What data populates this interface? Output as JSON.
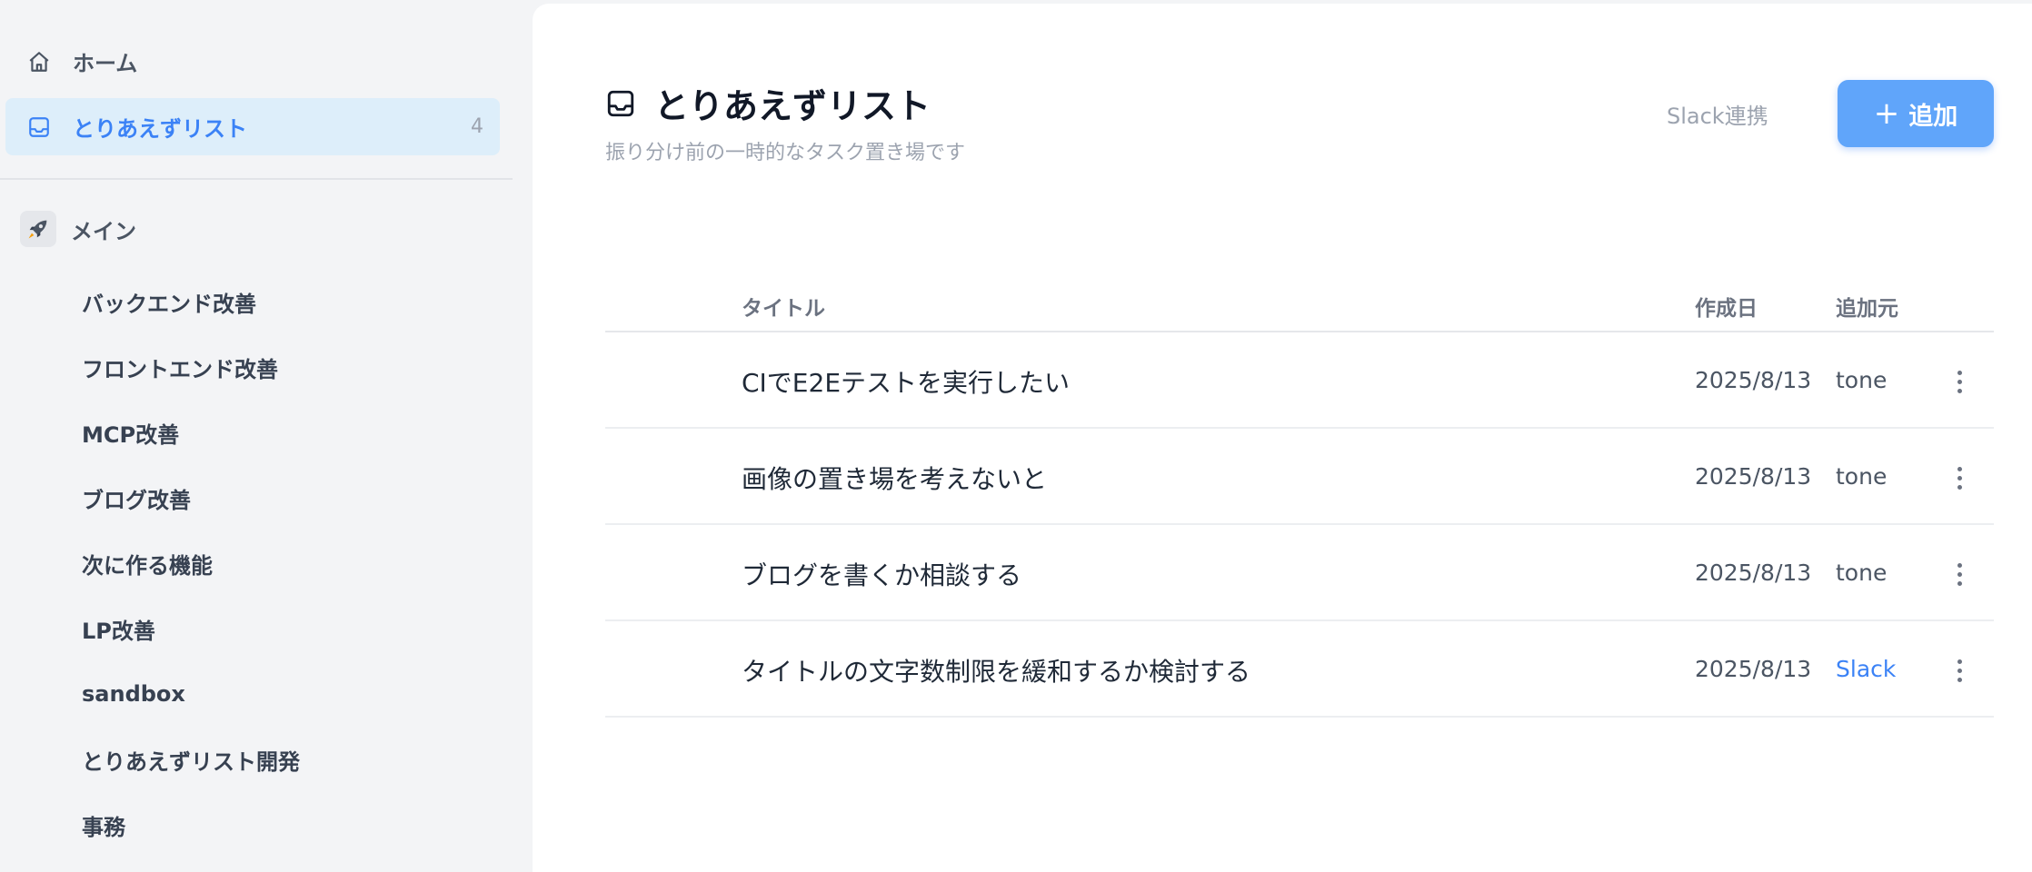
{
  "sidebar": {
    "nav": [
      {
        "label": "ホーム",
        "icon": "home-icon"
      },
      {
        "label": "とりあえずリスト",
        "icon": "inbox-icon",
        "count": "4",
        "active": true
      }
    ],
    "project": {
      "name": "メイン",
      "icon": "rocket-icon",
      "items": [
        {
          "label": "バックエンド改善"
        },
        {
          "label": "フロントエンド改善"
        },
        {
          "label": "MCP改善"
        },
        {
          "label": "ブログ改善"
        },
        {
          "label": "次に作る機能"
        },
        {
          "label": "LP改善"
        },
        {
          "label": "sandbox"
        },
        {
          "label": "とりあえずリスト開発"
        },
        {
          "label": "事務"
        }
      ]
    }
  },
  "header": {
    "title": "とりあえずリスト",
    "subtitle": "振り分け前の一時的なタスク置き場です",
    "slack_label": "Slack連携",
    "add_label": "追加"
  },
  "table": {
    "columns": {
      "title": "タイトル",
      "date": "作成日",
      "source": "追加元"
    },
    "rows": [
      {
        "title": "CIでE2Eテストを実行したい",
        "date": "2025/8/13",
        "source": "tone"
      },
      {
        "title": "画像の置き場を考えないと",
        "date": "2025/8/13",
        "source": "tone"
      },
      {
        "title": "ブログを書くか相談する",
        "date": "2025/8/13",
        "source": "tone"
      },
      {
        "title": "タイトルの文字数制限を緩和するか検討する",
        "date": "2025/8/13",
        "source": "Slack"
      }
    ]
  },
  "colors": {
    "accent": "#3b82f6",
    "active_bg": "#ddeefa",
    "button_bg": "#60a5fa"
  }
}
